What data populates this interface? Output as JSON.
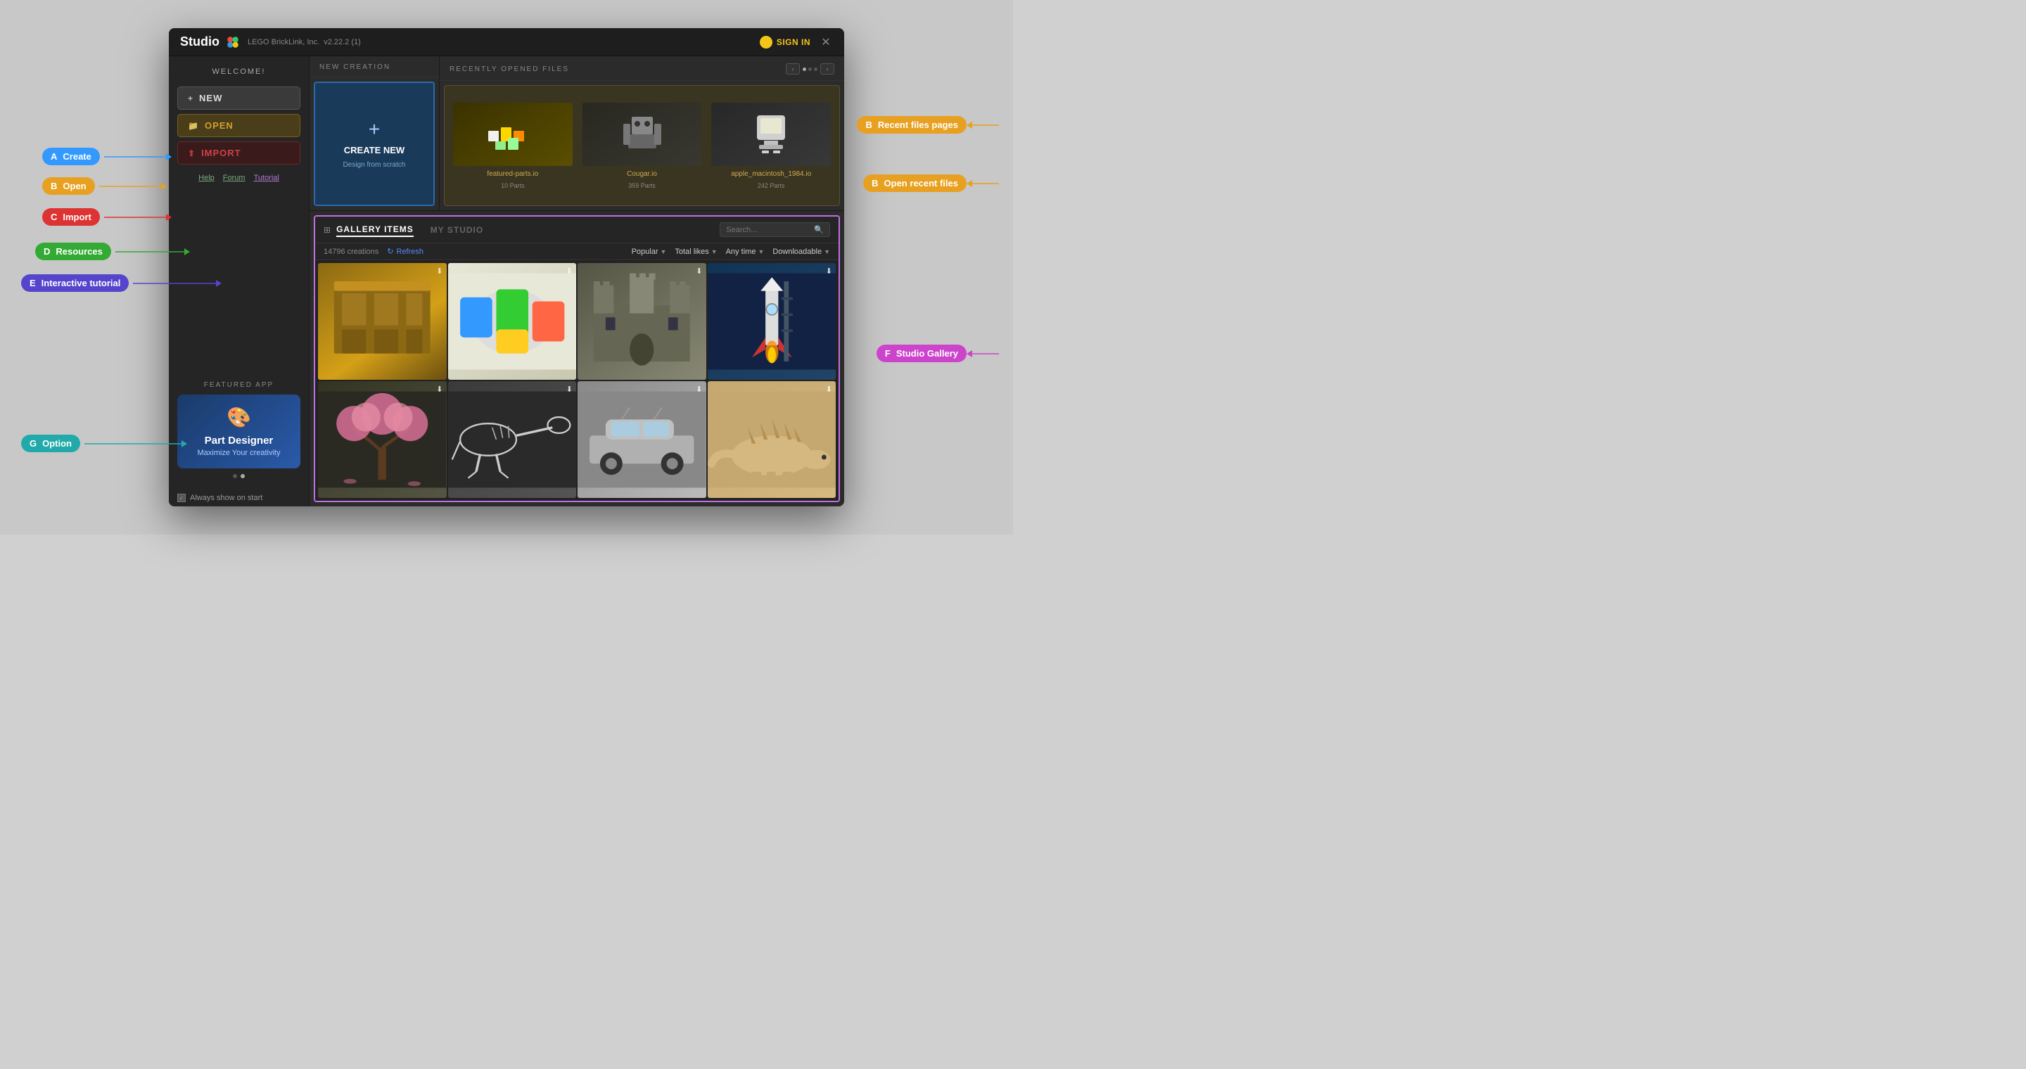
{
  "app": {
    "title": "Studio",
    "company": "LEGO BrickLink, Inc.",
    "version": "v2.22.2 (1)",
    "sign_in": "SIGN IN"
  },
  "sidebar": {
    "welcome": "WELCOME!",
    "btn_new": "NEW",
    "btn_open": "OPEN",
    "btn_import": "IMPORT",
    "link_help": "Help",
    "link_forum": "Forum",
    "link_tutorial": "Tutorial",
    "featured_label": "FEATURED APP",
    "featured_title": "Part Designer",
    "featured_subtitle": "Maximize Your creativity",
    "option_label": "Always show on start"
  },
  "new_creation": {
    "header": "NEW CREATION",
    "card_title": "CREATE NEW",
    "card_subtitle": "Design from scratch"
  },
  "recent_files": {
    "header": "RECENTLY OPENED FILES",
    "files": [
      {
        "name": "featured-parts.io",
        "parts": "10 Parts"
      },
      {
        "name": "Cougar.io",
        "parts": "359 Parts"
      },
      {
        "name": "apple_macintosh_1984.io",
        "parts": "242 Parts"
      }
    ]
  },
  "gallery": {
    "tab_gallery": "GALLERY ITEMS",
    "tab_my_studio": "MY STUDIO",
    "search_placeholder": "Search...",
    "count": "14796 creations",
    "refresh": "Refresh",
    "filter_popular": "Popular",
    "filter_likes": "Total likes",
    "filter_time": "Any time",
    "filter_download": "Downloadable"
  },
  "annotations": {
    "a": {
      "letter": "A",
      "label": "Create"
    },
    "b": {
      "letter": "B",
      "label": "Open"
    },
    "c": {
      "letter": "C",
      "label": "Import"
    },
    "d": {
      "letter": "D",
      "label": "Resources"
    },
    "e": {
      "letter": "E",
      "label": "Interactive tutorial"
    },
    "b2": {
      "letter": "B",
      "label": "Recent files pages"
    },
    "b3": {
      "letter": "B",
      "label": "Open recent files"
    },
    "f": {
      "letter": "F",
      "label": "Studio Gallery"
    },
    "g": {
      "letter": "G",
      "label": "Option"
    }
  }
}
